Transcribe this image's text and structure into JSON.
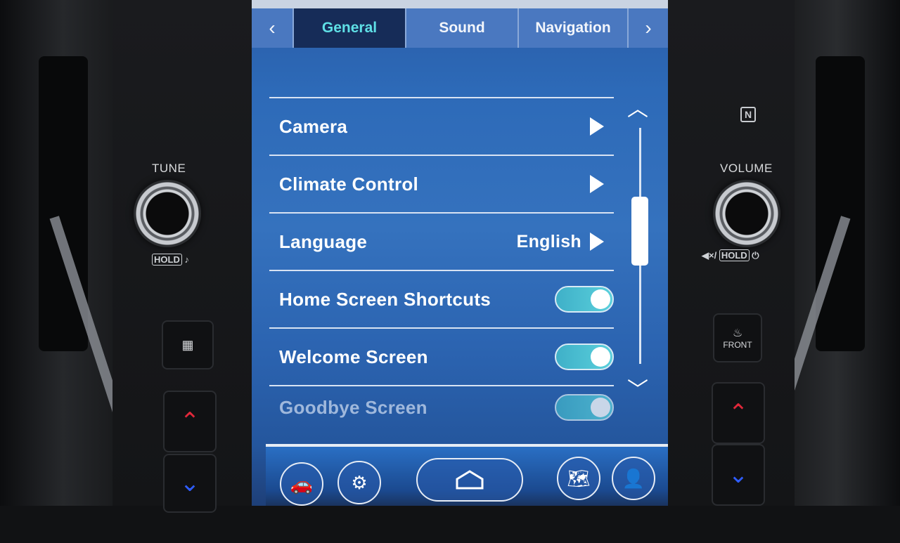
{
  "tabs": {
    "prev_icon": "chevron-left-icon",
    "items": [
      {
        "label": "General",
        "active": true
      },
      {
        "label": "Sound",
        "active": false
      },
      {
        "label": "Navigation",
        "active": false
      }
    ],
    "next_icon": "chevron-right-icon"
  },
  "settings": {
    "camera": {
      "label": "Camera"
    },
    "climate": {
      "label": "Climate Control"
    },
    "language": {
      "label": "Language",
      "value": "English"
    },
    "home_shortcuts": {
      "label": "Home Screen Shortcuts",
      "on": true
    },
    "welcome": {
      "label": "Welcome Screen",
      "on": true
    },
    "goodbye": {
      "label": "Goodbye Screen",
      "on": true
    }
  },
  "hardware": {
    "tune_label": "TUNE",
    "tune_sub": "HOLD",
    "volume_label": "VOLUME",
    "volume_sub": "HOLD",
    "front_defrost_label": "FRONT"
  },
  "colors": {
    "active_tab_text": "#5fe0e6",
    "toggle_on": "#4cc0d4",
    "up_arrow": "#e0283a",
    "down_arrow": "#2f5dff"
  }
}
